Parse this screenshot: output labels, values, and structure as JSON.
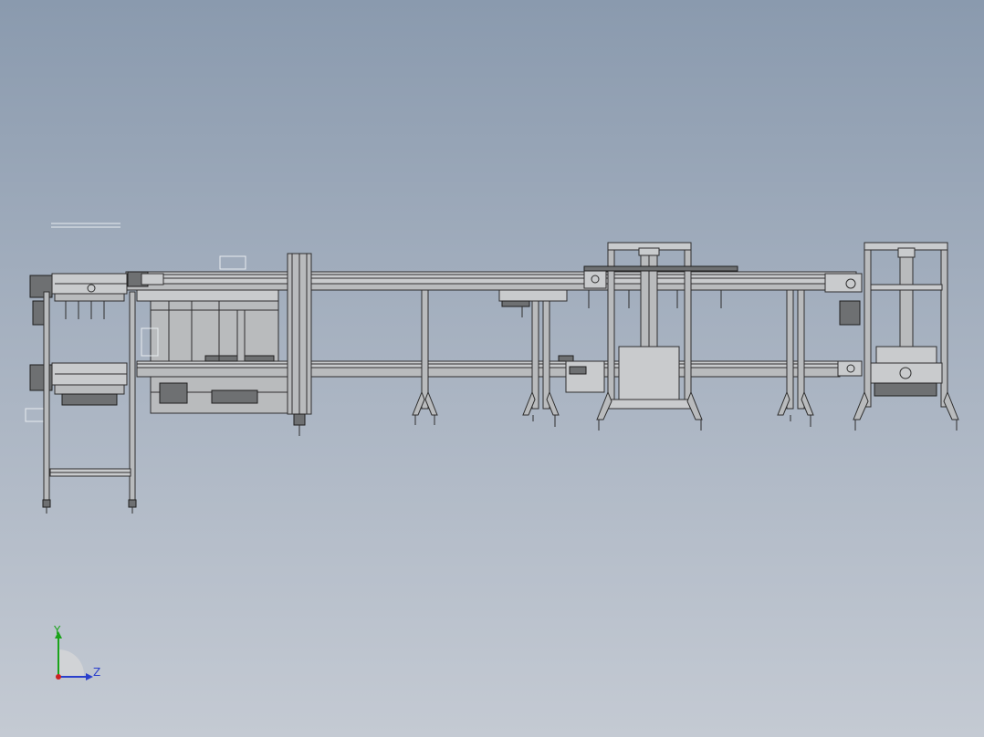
{
  "viewport": {
    "background_top": "#8a9aae",
    "background_bottom": "#c4cad3",
    "model_description_color": "#3a3a3a"
  },
  "triad": {
    "y_label": "Y",
    "z_label": "Z",
    "y_color": "#1aa31a",
    "z_color": "#2a3fcc",
    "x_color": "#cc2222"
  }
}
